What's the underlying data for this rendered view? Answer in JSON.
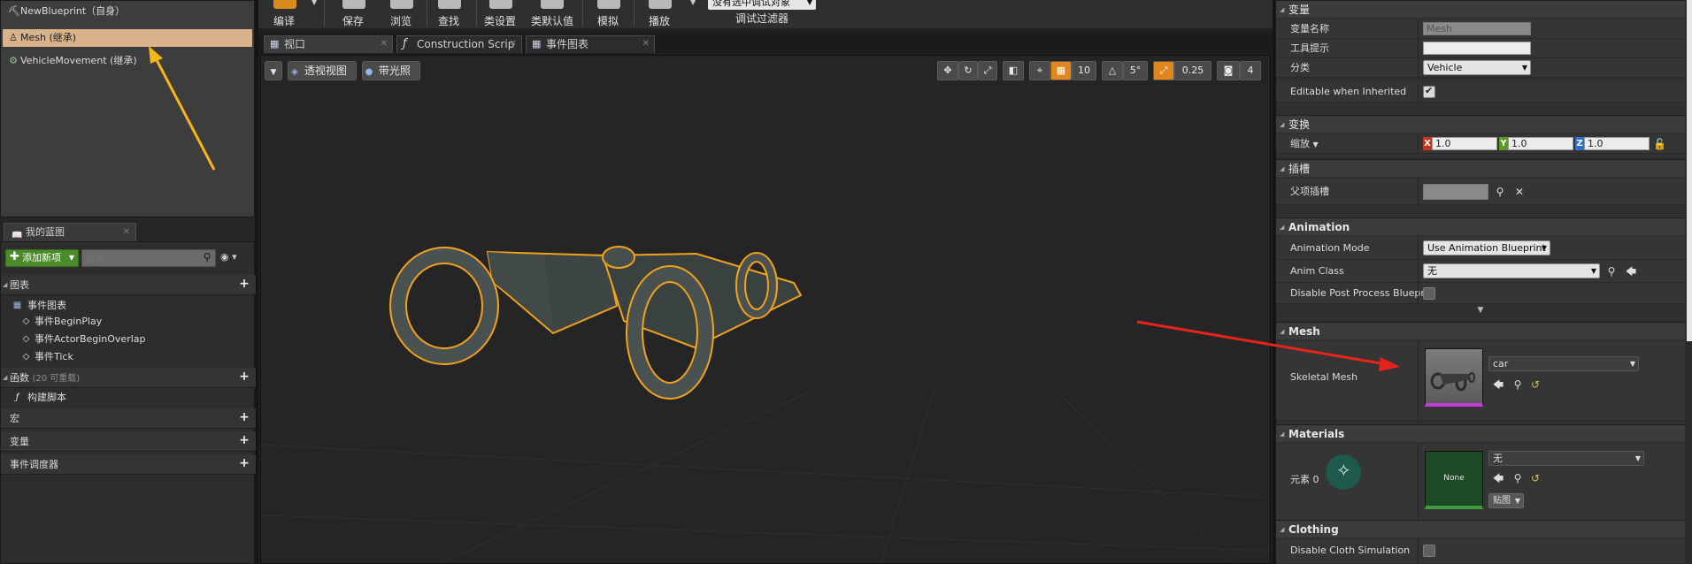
{
  "components": {
    "root": "NewBlueprint（自身）",
    "items": [
      {
        "label": "Mesh (继承)",
        "selected": true
      },
      {
        "label": "VehicleMovement (继承)",
        "selected": false
      }
    ]
  },
  "toolbar": {
    "buttons": [
      "编译",
      "保存",
      "浏览",
      "查找",
      "类设置",
      "类默认值",
      "模拟",
      "播放"
    ],
    "debug_select": "没有选中调试对象",
    "debug_label": "调试过滤器"
  },
  "my_blueprint": {
    "tab": "我的蓝图",
    "add_new": "添加新项",
    "search_placeholder": "搜索",
    "sections": {
      "graphs": "图表",
      "event_graph": "事件图表",
      "events": [
        "事件BeginPlay",
        "事件ActorBeginOverlap",
        "事件Tick"
      ],
      "functions": "函数",
      "functions_count": "(20 可重载)",
      "construction_script": "构建脚本",
      "macros": "宏",
      "variables": "变量",
      "dispatchers": "事件调度器"
    }
  },
  "doc_tabs": [
    "视口",
    "Construction Scrip",
    "事件图表"
  ],
  "viewport": {
    "perspective": "透视视图",
    "lit": "带光照",
    "grid_snap": "10",
    "rot_snap": "5°",
    "scale_snap": "0.25",
    "cam_speed": "4"
  },
  "details": {
    "variable": {
      "title": "变量",
      "name_label": "变量名称",
      "name_value": "Mesh",
      "tooltip_label": "工具提示",
      "tooltip_value": "",
      "category_label": "分类",
      "category_value": "Vehicle",
      "editable_label": "Editable when Inherited",
      "editable_checked": true
    },
    "transform": {
      "title": "变换",
      "scale_label": "缩放",
      "x": "1.0",
      "y": "1.0",
      "z": "1.0",
      "x_label": "X",
      "y_label": "Y",
      "z_label": "Z"
    },
    "sockets": {
      "title": "插槽",
      "parent_label": "父项插槽"
    },
    "animation": {
      "title": "Animation",
      "mode_label": "Animation Mode",
      "mode_value": "Use Animation Blueprint",
      "class_label": "Anim Class",
      "class_value": "无",
      "post_label": "Disable Post Process Bluepri"
    },
    "mesh": {
      "title": "Mesh",
      "skeletal_label": "Skeletal Mesh",
      "asset": "car"
    },
    "materials": {
      "title": "Materials",
      "element_label": "元素 0",
      "asset": "无",
      "thumb_text": "None",
      "texture_btn": "贴图"
    },
    "clothing": {
      "title": "Clothing",
      "disable_label": "Disable Cloth Simulation"
    }
  },
  "colors": {
    "selection": "#d7b28a",
    "accent_orange": "#e0861d",
    "add_green": "#4a8a2a",
    "arrow_yellow": "#f5b619",
    "arrow_red": "#e8231c"
  }
}
